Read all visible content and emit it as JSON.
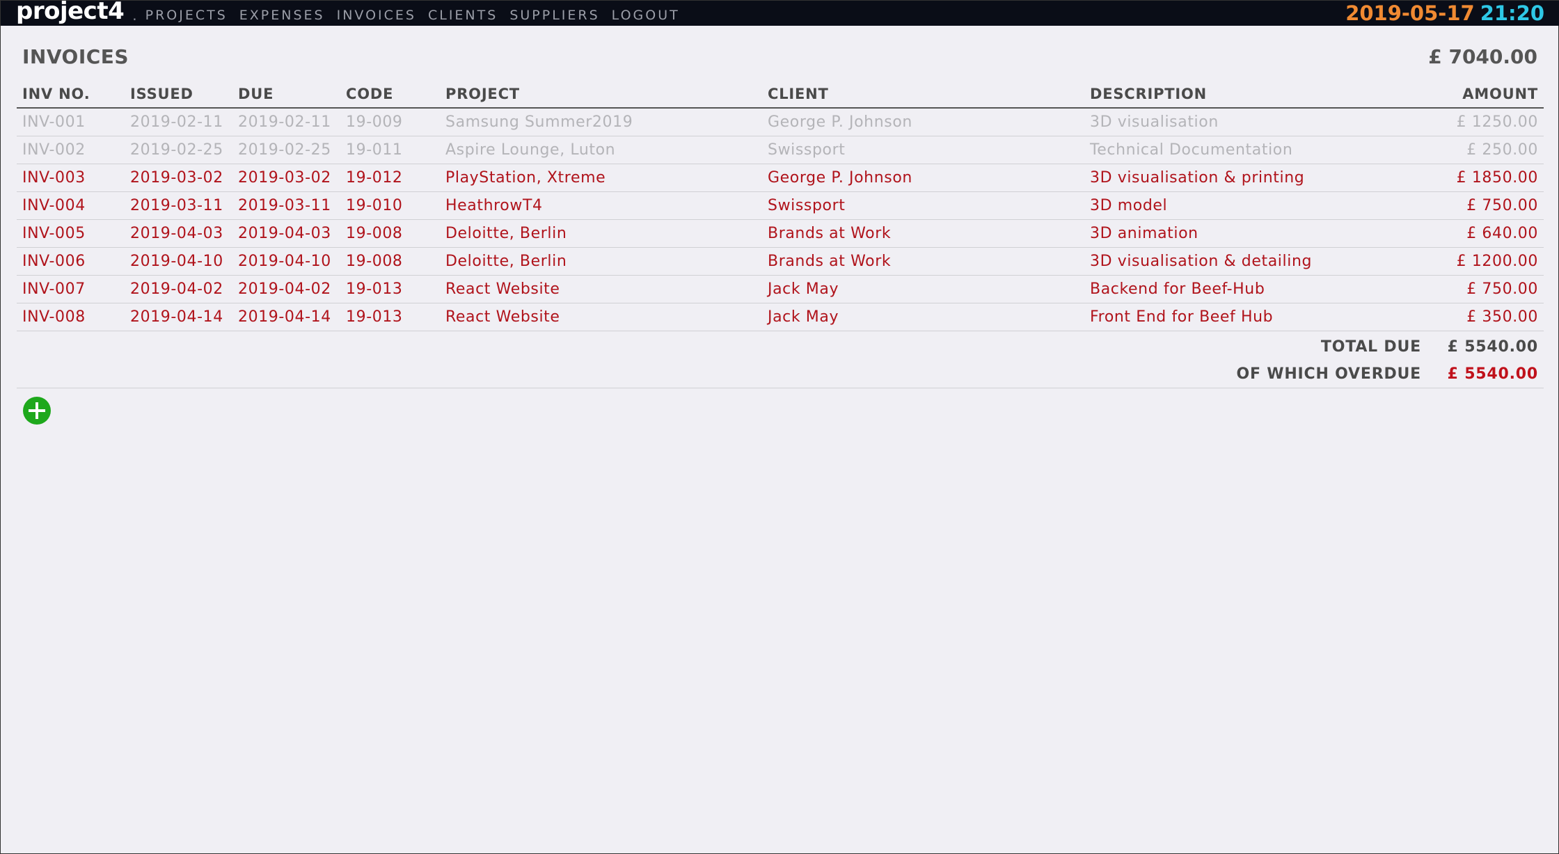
{
  "app": {
    "title": "project4",
    "separator": "."
  },
  "nav": [
    "PROJECTS",
    "EXPENSES",
    "INVOICES",
    "CLIENTS",
    "SUPPLIERS",
    "LOGOUT"
  ],
  "clock": {
    "date": "2019-05-17",
    "time": "21:20",
    "date_color": "#f08a32",
    "time_color": "#2ec8e6"
  },
  "page": {
    "title": "INVOICES",
    "total": "£ 7040.00"
  },
  "table": {
    "columns": [
      "INV NO.",
      "ISSUED",
      "DUE",
      "CODE",
      "PROJECT",
      "CLIENT",
      "DESCRIPTION",
      "AMOUNT"
    ],
    "rows": [
      {
        "status": "paid",
        "cells": [
          "INV-001",
          "2019-02-11",
          "2019-02-11",
          "19-009",
          "Samsung Summer2019",
          "George P. Johnson",
          "3D visualisation",
          "£ 1250.00"
        ]
      },
      {
        "status": "paid",
        "cells": [
          "INV-002",
          "2019-02-25",
          "2019-02-25",
          "19-011",
          "Aspire Lounge, Luton",
          "Swissport",
          "Technical Documentation",
          "£ 250.00"
        ]
      },
      {
        "status": "overdue",
        "cells": [
          "INV-003",
          "2019-03-02",
          "2019-03-02",
          "19-012",
          "PlayStation, Xtreme",
          "George P. Johnson",
          "3D visualisation & printing",
          "£ 1850.00"
        ]
      },
      {
        "status": "overdue",
        "cells": [
          "INV-004",
          "2019-03-11",
          "2019-03-11",
          "19-010",
          "HeathrowT4",
          "Swissport",
          "3D model",
          "£ 750.00"
        ]
      },
      {
        "status": "overdue",
        "cells": [
          "INV-005",
          "2019-04-03",
          "2019-04-03",
          "19-008",
          "Deloitte, Berlin",
          "Brands at Work",
          "3D animation",
          "£ 640.00"
        ]
      },
      {
        "status": "overdue",
        "cells": [
          "INV-006",
          "2019-04-10",
          "2019-04-10",
          "19-008",
          "Deloitte, Berlin",
          "Brands at Work",
          "3D visualisation & detailing",
          "£ 1200.00"
        ]
      },
      {
        "status": "overdue",
        "cells": [
          "INV-007",
          "2019-04-02",
          "2019-04-02",
          "19-013",
          "React Website",
          "Jack May",
          "Backend for Beef-Hub",
          "£ 750.00"
        ]
      },
      {
        "status": "overdue",
        "cells": [
          "INV-008",
          "2019-04-14",
          "2019-04-14",
          "19-013",
          "React Website",
          "Jack May",
          "Front End for Beef Hub",
          "£ 350.00"
        ]
      }
    ]
  },
  "summary": {
    "total_due_label": "TOTAL DUE",
    "total_due_value": "£ 5540.00",
    "overdue_label": "OF WHICH OVERDUE",
    "overdue_value": "£ 5540.00"
  },
  "colors": {
    "overdue": "#b0131b",
    "paid": "#b4b4b8",
    "add_button": "#1ea81c",
    "topbar": "#0a0d17"
  },
  "icons": {
    "add": "plus-circle-icon"
  }
}
